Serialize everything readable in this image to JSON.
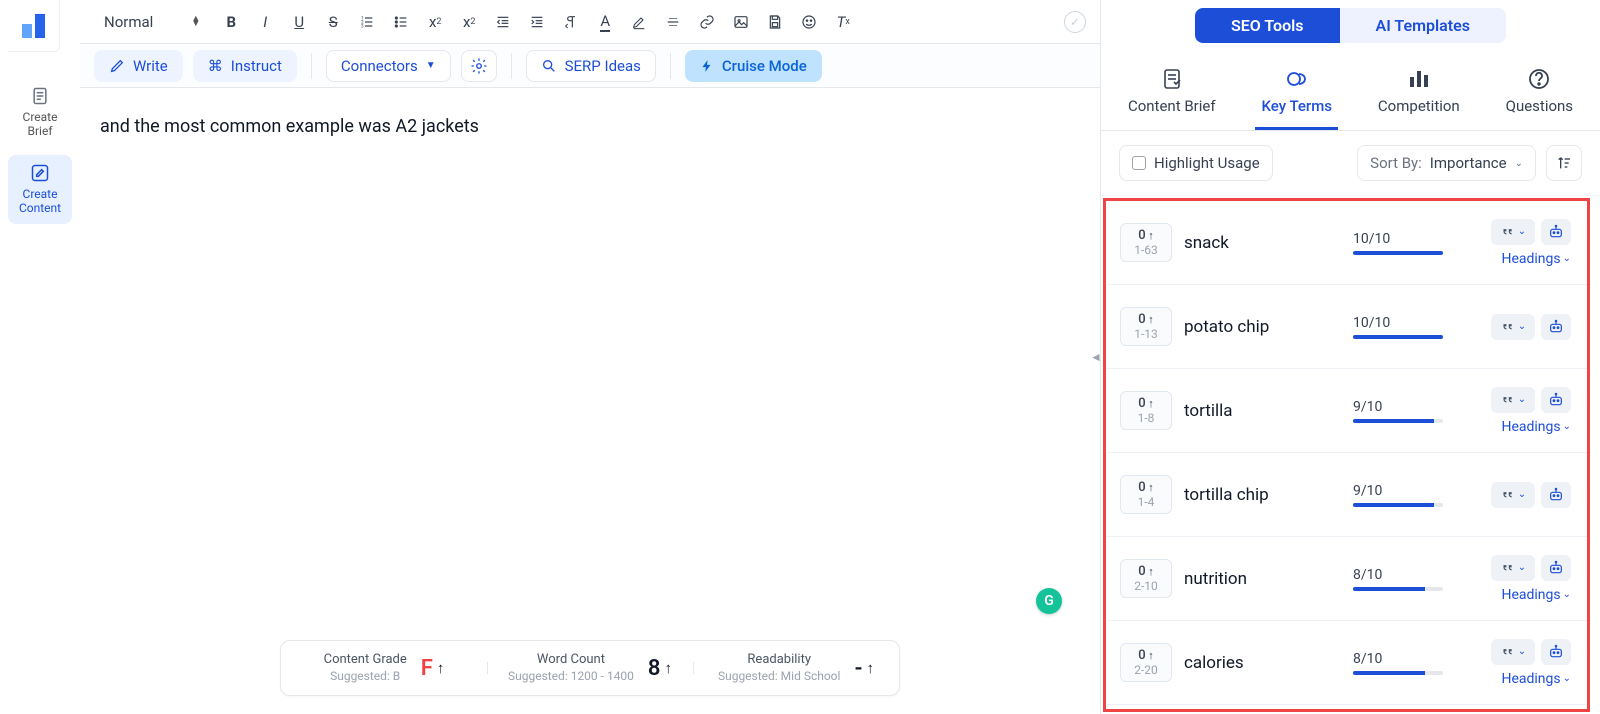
{
  "left_rail": {
    "create_brief": "Create\nBrief",
    "create_content": "Create\nContent"
  },
  "fmt": {
    "style": "Normal"
  },
  "actions": {
    "write": "Write",
    "instruct": "Instruct",
    "connectors": "Connectors",
    "serp_ideas": "SERP Ideas",
    "cruise": "Cruise Mode"
  },
  "editor": {
    "content": "and the most common example was A2 jackets"
  },
  "metrics": {
    "grade_title": "Content Grade",
    "grade_sub": "Suggested: B",
    "grade_val": "F",
    "wc_title": "Word Count",
    "wc_sub": "Suggested: 1200 - 1400",
    "wc_val": "8",
    "read_title": "Readability",
    "read_sub": "Suggested: Mid School",
    "read_val": "-"
  },
  "rpanel": {
    "seo_tools": "SEO Tools",
    "ai_templates": "AI Templates",
    "tabs": {
      "brief": "Content Brief",
      "keyterms": "Key Terms",
      "competition": "Competition",
      "questions": "Questions"
    },
    "filters": {
      "highlight": "Highlight Usage",
      "sort_label": "Sort By:",
      "sort_value": "Importance"
    },
    "headings_label": "Headings",
    "terms": [
      {
        "count": "0",
        "range": "1-63",
        "name": "snack",
        "score": "10/10",
        "fill": 100,
        "show_headings": true
      },
      {
        "count": "0",
        "range": "1-13",
        "name": "potato chip",
        "score": "10/10",
        "fill": 100,
        "show_headings": false
      },
      {
        "count": "0",
        "range": "1-8",
        "name": "tortilla",
        "score": "9/10",
        "fill": 90,
        "show_headings": true
      },
      {
        "count": "0",
        "range": "1-4",
        "name": "tortilla chip",
        "score": "9/10",
        "fill": 90,
        "show_headings": false
      },
      {
        "count": "0",
        "range": "2-10",
        "name": "nutrition",
        "score": "8/10",
        "fill": 80,
        "show_headings": true
      },
      {
        "count": "0",
        "range": "2-20",
        "name": "calories",
        "score": "8/10",
        "fill": 80,
        "show_headings": true
      }
    ]
  },
  "misc": {
    "grammarly": "G"
  }
}
